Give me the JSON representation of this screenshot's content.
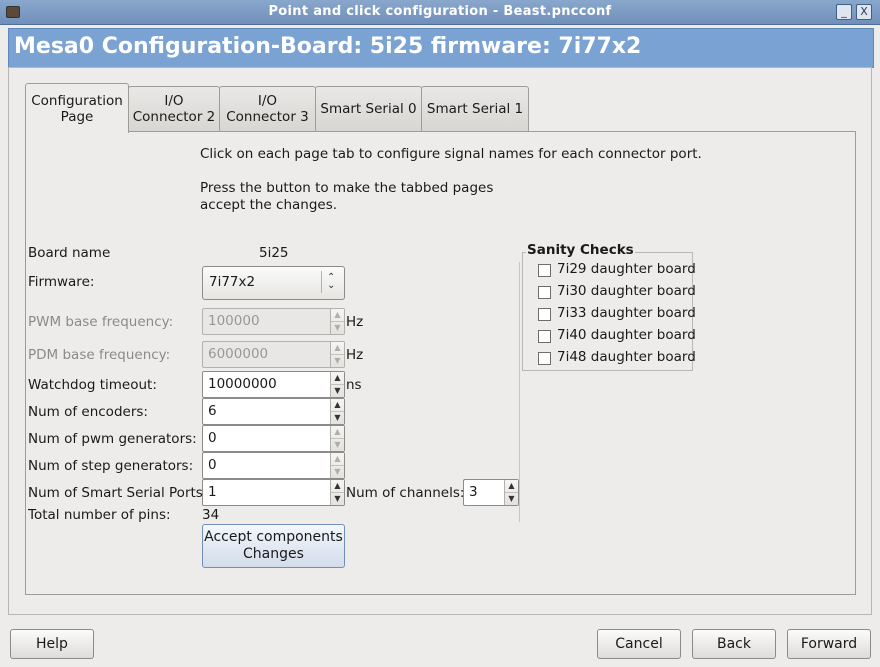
{
  "window": {
    "title": "Point and click configuration - Beast.pncconf",
    "minimize_icon": "_",
    "close_icon": "X"
  },
  "header": {
    "title": "Mesa0 Configuration-Board: 5i25 firmware: 7i77x2"
  },
  "tabs": [
    {
      "label_line1": "Configuration",
      "label_line2": "Page",
      "active": true
    },
    {
      "label_line1": "I/O",
      "label_line2": "Connector 2",
      "active": false
    },
    {
      "label_line1": "I/O",
      "label_line2": "Connector 3",
      "active": false
    },
    {
      "label_line1": "Smart Serial 0",
      "label_line2": "",
      "active": false
    },
    {
      "label_line1": "Smart Serial 1",
      "label_line2": "",
      "active": false
    }
  ],
  "instructions": {
    "line1": "Click on each page tab to configure signal names for each connector port.",
    "line2": "Press the button to make the tabbed pages",
    "line3": "accept the changes."
  },
  "form": {
    "board_name_label": "Board name",
    "board_name_value": "5i25",
    "firmware_label": "Firmware:",
    "firmware_value": "7i77x2",
    "pwm_label": "PWM base frequency:",
    "pwm_value": "100000",
    "pwm_unit": "Hz",
    "pdm_label": "PDM base frequency:",
    "pdm_value": "6000000",
    "pdm_unit": "Hz",
    "watchdog_label": "Watchdog timeout:",
    "watchdog_value": "10000000",
    "watchdog_unit": "ns",
    "encoders_label": "Num of encoders:",
    "encoders_value": "6",
    "pwm_gen_label": "Num of pwm generators:",
    "pwm_gen_value": "0",
    "step_gen_label": "Num of step generators:",
    "step_gen_value": "0",
    "sserial_label": "Num of Smart Serial Ports:",
    "sserial_value": "1",
    "channels_label": "Num of channels:",
    "channels_value": "3",
    "total_pins_label": "Total number of pins:",
    "total_pins_value": "34",
    "accept_line1": "Accept  components",
    "accept_line2": "Changes"
  },
  "sanity": {
    "title": "Sanity Checks",
    "items": [
      {
        "label": "7i29 daughter board",
        "checked": false
      },
      {
        "label": "7i30 daughter board",
        "checked": false
      },
      {
        "label": "7i33 daughter board",
        "checked": false
      },
      {
        "label": "7i40 daughter board",
        "checked": false
      },
      {
        "label": "7i48 daughter board",
        "checked": false
      }
    ]
  },
  "footer": {
    "help_label": "Help",
    "cancel_label": "Cancel",
    "back_label": "Back",
    "forward_label": "Forward"
  }
}
